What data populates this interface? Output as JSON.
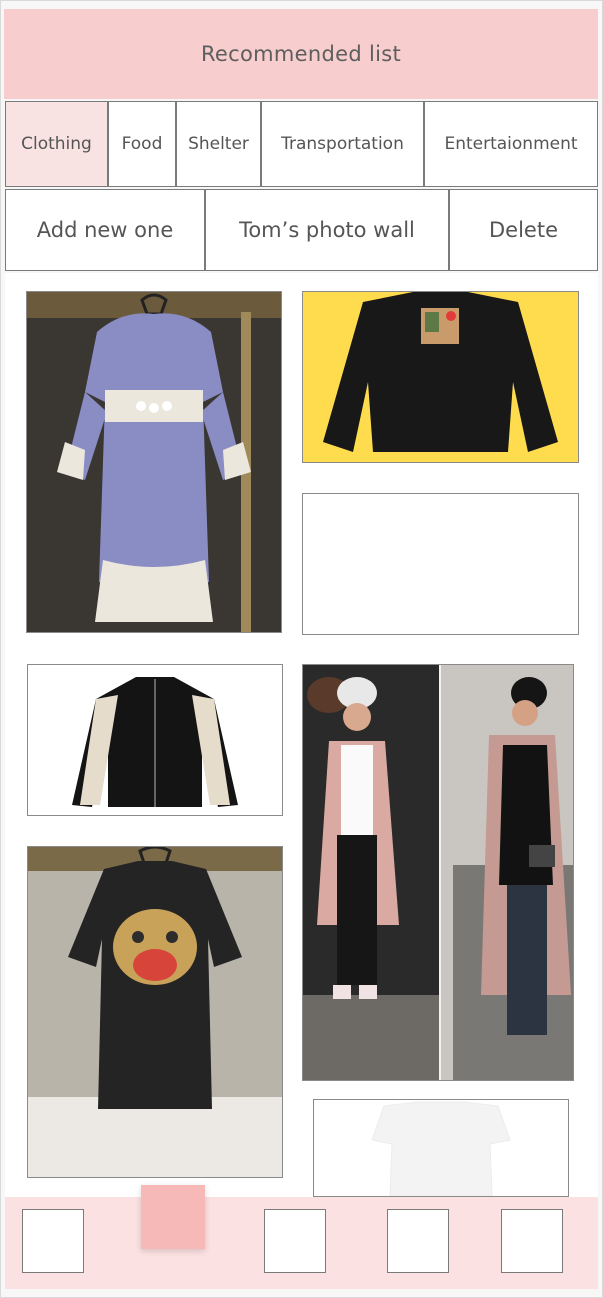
{
  "header": {
    "title": "Recommended list"
  },
  "tabs": [
    {
      "label": "Clothing",
      "active": true
    },
    {
      "label": "Food",
      "active": false
    },
    {
      "label": "Shelter",
      "active": false
    },
    {
      "label": "Transportation",
      "active": false
    },
    {
      "label": "Entertaionment",
      "active": false
    }
  ],
  "actions": {
    "add_label": "Add new one",
    "wall_label": "Tom’s photo wall",
    "delete_label": "Delete"
  },
  "gallery": {
    "items": [
      {
        "name": "lavender-dress"
      },
      {
        "name": "black-sweatshirt"
      },
      {
        "name": "empty-card"
      },
      {
        "name": "black-jacket"
      },
      {
        "name": "pink-coat-outfits"
      },
      {
        "name": "black-tiger-tshirt"
      },
      {
        "name": "white-tshirt"
      }
    ]
  },
  "bottom_nav": {
    "items": [
      "home-tab",
      "list-tab",
      "add-tab",
      "messages-tab",
      "profile-tab"
    ],
    "active_index": 1
  },
  "colors": {
    "header_bg": "#f7cdcd",
    "active_tab_bg": "#f9e2e2",
    "bottom_bg": "#fbe1e1",
    "active_nav": "#f7b8b8",
    "sweatshirt_bg": "#fedc4d"
  }
}
